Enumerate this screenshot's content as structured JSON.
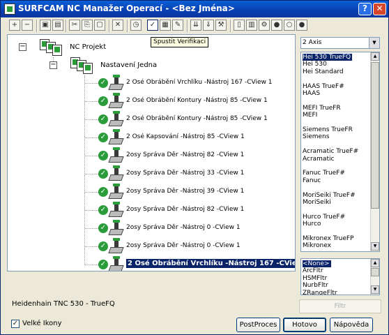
{
  "window": {
    "title": "SURFCAM NC Manažer Operací - <Bez Jména>",
    "help_glyph": "?",
    "close_glyph": "✕"
  },
  "toolbar": {
    "buttons": [
      {
        "name": "expand-icon",
        "glyph": "+"
      },
      {
        "name": "collapse-icon",
        "glyph": "−"
      },
      {
        "name": "copy-op-icon",
        "glyph": "▣"
      },
      {
        "name": "move-op-icon",
        "glyph": "▤"
      },
      {
        "name": "cut-icon",
        "glyph": "✂"
      },
      {
        "name": "copy-icon",
        "glyph": "⎘"
      },
      {
        "name": "paste-icon",
        "glyph": "▢"
      },
      {
        "name": "delete-icon",
        "glyph": "✕"
      },
      {
        "name": "time-icon",
        "glyph": "◷"
      },
      {
        "name": "verify-icon",
        "glyph": "✓"
      },
      {
        "name": "verify-stack-icon",
        "glyph": "▦"
      },
      {
        "name": "simulate-icon",
        "glyph": "✎"
      },
      {
        "name": "sim-red-icon",
        "glyph": "⇊"
      },
      {
        "name": "sim-down-icon",
        "glyph": "⇓"
      },
      {
        "name": "tool-icon",
        "glyph": "⚒"
      },
      {
        "name": "page-icon",
        "glyph": "▯"
      },
      {
        "name": "post-icon",
        "glyph": "▥"
      },
      {
        "name": "setup-icon",
        "glyph": "⚙"
      },
      {
        "name": "green-dots-icon",
        "glyph": "●"
      },
      {
        "name": "grey-dots-icon",
        "glyph": "○"
      },
      {
        "name": "green-dots-2-icon",
        "glyph": "●"
      }
    ],
    "tooltip": "Spustit Verifikaci"
  },
  "tree": {
    "root_label": "NC Projekt",
    "setup_label": "Nastavení Jedna",
    "expander_glyph": "−",
    "check_glyph": "✓",
    "operations": [
      "2 Osé Obrábění Vrchlíku  -Nástroj 167 -CView 1",
      "2 Osé Obrábění Kontury  -Nástroj 85 -CView 1",
      "2 Osé Obrábění Kontury  -Nástroj 85 -CView 1",
      "2 Osé Kapsování  -Nástroj 85 -CView 1",
      "2osy Správa Děr  -Nástroj 82 -CView 1",
      "2osy Správa Děr  -Nástroj 33 -CView 1",
      "2osy Správa Děr  -Nástroj 39 -CView 1",
      "2osy Správa Děr  -Nástroj 82 -CView 1",
      "2osy Správa Děr  -Nástroj 0 -CView 1",
      "2osy Správa Děr  -Nástroj 0 -CView 1",
      "2 Osé Obrábění Vrchlíku  -Nástroj 167 -CView 4"
    ],
    "selected_index": 10
  },
  "axis_combo": {
    "value": "2 Axis",
    "arrow_glyph": "▼"
  },
  "post_list": {
    "items": [
      "Hei 530 TrueFQ",
      "Hei 530",
      "Hei Standard",
      "",
      "HAAS TrueF#",
      "HAAS",
      "",
      "MEFI TrueFR",
      "MEFI",
      "",
      "Siemens TrueFR",
      "Siemens",
      "",
      "Acramatic TrueF#",
      "Acramatic",
      "",
      "Fanuc TrueF#",
      "Fanuc",
      "",
      "MoriSeiki TrueF#",
      "MoriSeiki",
      "",
      "Hurco TrueF#",
      "Hurco",
      "",
      "Mikronex TrueFP",
      "Mikronex"
    ],
    "selected_index": 0
  },
  "filter_list": {
    "items": [
      "<None>",
      "ArcFltr",
      "HSMFltr",
      "NurbFltr",
      "ZRangeFltr"
    ],
    "selected_index": 0
  },
  "scroll": {
    "up_glyph": "▲",
    "down_glyph": "▼"
  },
  "status": {
    "post_name": "Heidenhain TNC 530 - TrueFQ"
  },
  "filtr_button": "Filtr",
  "large_icons": {
    "label": "Velké Ikony",
    "checked_glyph": "✓"
  },
  "buttons": {
    "postproces": "PostProces",
    "hotovo": "Hotovo",
    "napoveda": "Nápověda"
  }
}
